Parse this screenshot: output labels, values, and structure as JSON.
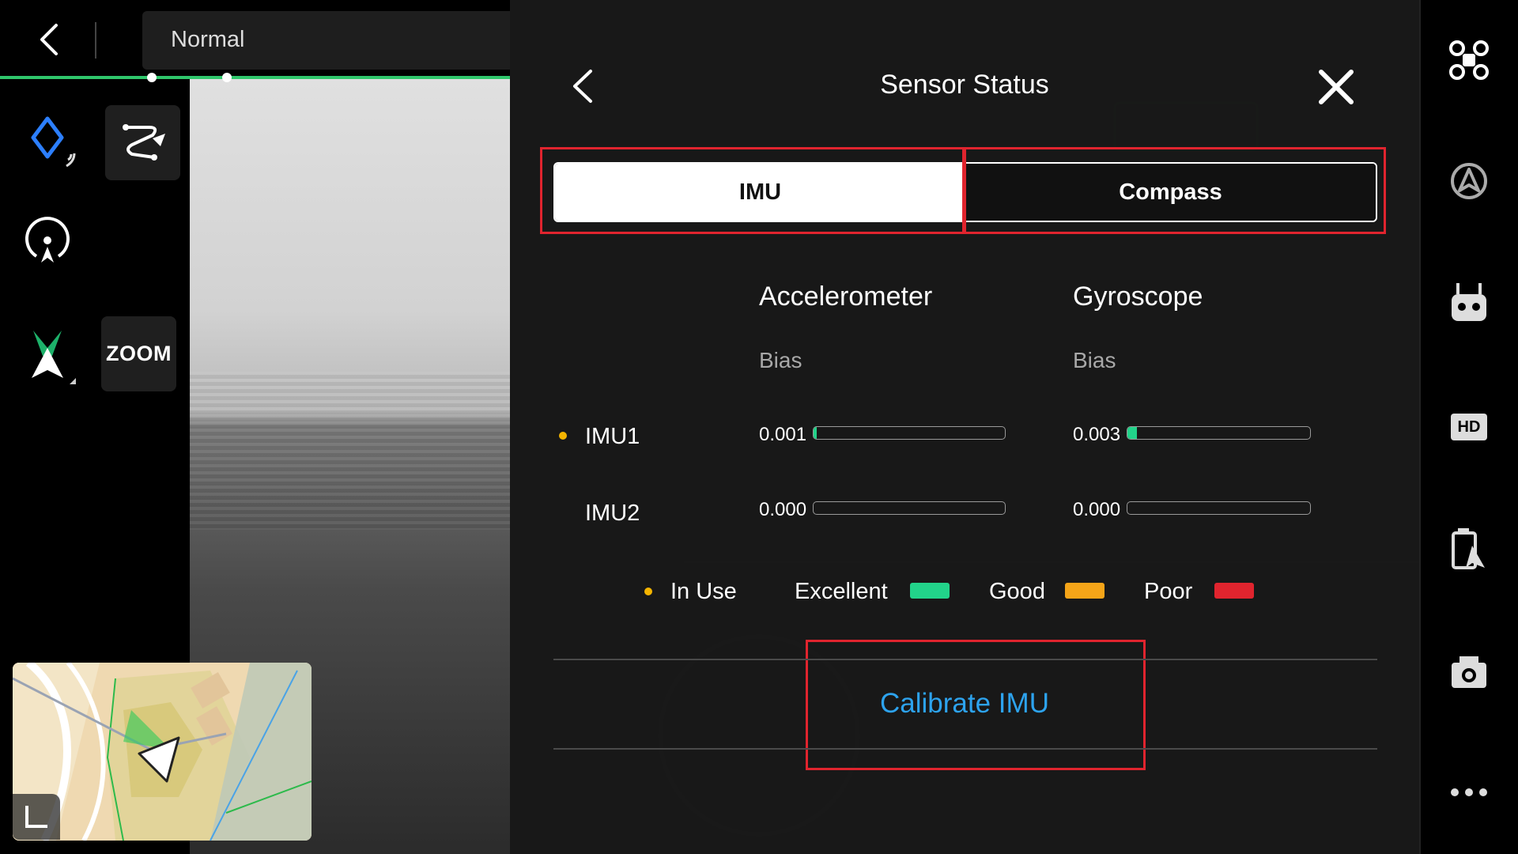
{
  "header": {
    "back_icon": "chevron-left-icon",
    "flight_mode": "Normal"
  },
  "left_tools": {
    "zoom_label": "ZOOM",
    "icons": [
      "waypoint-diamond-icon",
      "route-path-icon",
      "target-location-icon",
      "return-home-icon"
    ]
  },
  "dialog": {
    "title": "Sensor Status",
    "tabs": [
      {
        "label": "IMU",
        "selected": true
      },
      {
        "label": "Compass",
        "selected": false
      }
    ],
    "columns": [
      {
        "header": "Accelerometer",
        "sub": "Bias"
      },
      {
        "header": "Gyroscope",
        "sub": "Bias"
      }
    ],
    "rows": [
      {
        "label": "IMU1",
        "in_use": true,
        "accel": {
          "value": "0.001",
          "level": 0.01
        },
        "gyro": {
          "value": "0.003",
          "level": 0.05
        }
      },
      {
        "label": "IMU2",
        "in_use": false,
        "accel": {
          "value": "0.000",
          "level": 0
        },
        "gyro": {
          "value": "0.000",
          "level": 0
        }
      }
    ],
    "legend": {
      "in_use": "In Use",
      "excellent": "Excellent",
      "good": "Good",
      "poor": "Poor"
    },
    "colors": {
      "in_use": "#f4b400",
      "excellent": "#22d38a",
      "good": "#f4a418",
      "poor": "#e0242e",
      "link": "#2da3ee",
      "highlight": "#e0242e"
    },
    "calibrate_label": "Calibrate IMU"
  },
  "right_bar": {
    "icons": [
      "drone-icon",
      "obstacle-avoidance-icon",
      "remote-controller-icon",
      "hd-icon",
      "battery-icon",
      "camera-icon",
      "more-icon"
    ],
    "hd_label": "HD"
  }
}
